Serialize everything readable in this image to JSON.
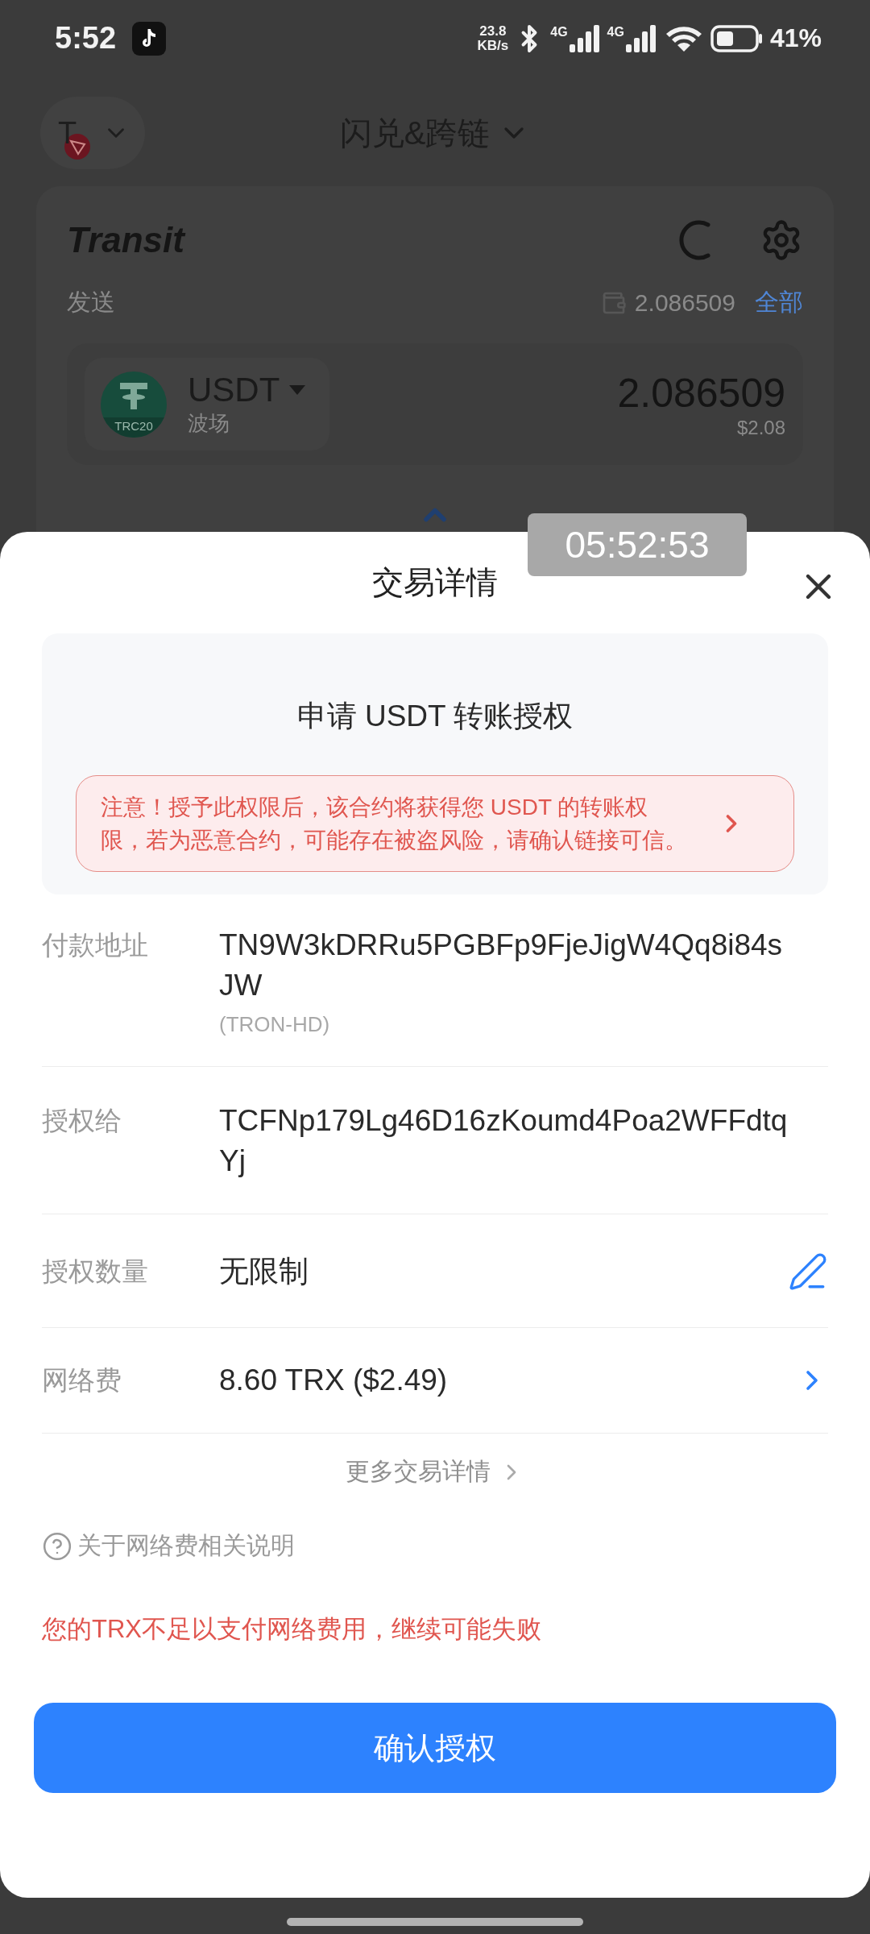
{
  "status_bar": {
    "time": "5:52",
    "net_speed": "23.8",
    "net_unit": "KB/s",
    "sim_labels": [
      "4G",
      "4G"
    ],
    "battery": "41%"
  },
  "header": {
    "chain_letter": "T",
    "title": "闪兑&跨链"
  },
  "swap_card": {
    "brand": "Transit",
    "send_label": "发送",
    "balance": "2.086509",
    "max_link": "全部",
    "token": {
      "symbol": "USDT",
      "badge": "TRC20",
      "network": "波场"
    },
    "amount": "2.086509",
    "amount_usd": "$2.08"
  },
  "recording_time": "05:52:53",
  "sheet": {
    "title": "交易详情",
    "request_title": "申请 USDT 转账授权",
    "warning": "注意！授予此权限后，该合约将获得您 USDT 的转账权限，若为恶意合约，可能存在被盗风险，请确认链接可信。",
    "rows": [
      {
        "kind": "address",
        "label": "付款地址",
        "value": "TN9W3kDRRu5PGBFp9FjeJigW4Qq8i84sJW",
        "note": "(TRON-HD)"
      },
      {
        "kind": "address",
        "label": "授权给",
        "value": "TCFNp179Lg46D16zKoumd4Poa2WFFdtqYj"
      },
      {
        "kind": "edit",
        "label": "授权数量",
        "value": "无限制"
      },
      {
        "kind": "link",
        "label": "网络费",
        "value": "8.60 TRX ($2.49)"
      }
    ],
    "more_link": "更多交易详情",
    "help_link": "关于网络费相关说明",
    "error": "您的TRX不足以支付网络费用，继续可能失败",
    "confirm_button": "确认授权"
  }
}
